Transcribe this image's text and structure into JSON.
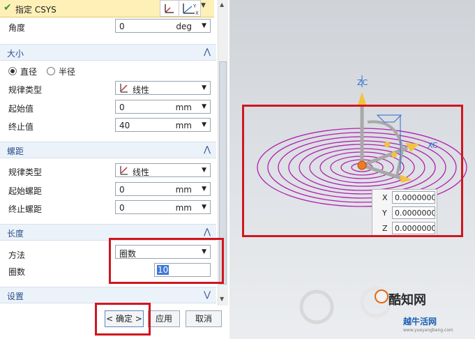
{
  "csys": {
    "label": "指定 CSYS"
  },
  "angle": {
    "label": "角度",
    "value": "0",
    "unit": "deg"
  },
  "size": {
    "title": "大小",
    "radio_diameter": "直径",
    "radio_radius": "半径",
    "law_type_label": "规律类型",
    "law_type_value": "线性",
    "start_label": "起始值",
    "start_value": "0",
    "start_unit": "mm",
    "end_label": "终止值",
    "end_value": "40",
    "end_unit": "mm"
  },
  "pitch": {
    "title": "螺距",
    "law_type_label": "规律类型",
    "law_type_value": "线性",
    "start_label": "起始螺距",
    "start_value": "0",
    "start_unit": "mm",
    "end_label": "终止螺距",
    "end_value": "0",
    "end_unit": "mm"
  },
  "length": {
    "title": "长度",
    "method_label": "方法",
    "method_value": "圈数",
    "turns_label": "圈数",
    "turns_value": "10"
  },
  "settings": {
    "title": "设置"
  },
  "buttons": {
    "ok": "< 确定 >",
    "apply": "应用",
    "cancel": "取消"
  },
  "viewport": {
    "axis_z": "ZC",
    "axis_x": "XC",
    "coords": [
      {
        "axis": "X",
        "value": "0.0000000"
      },
      {
        "axis": "Y",
        "value": "0.0000000"
      },
      {
        "axis": "Z",
        "value": "0.0000000"
      }
    ]
  },
  "watermark": {
    "brand": "酷知网",
    "cn": "越牛活网",
    "url": "www.yueyangbang.com"
  },
  "colors": {
    "highlight_red": "#d0161f",
    "spiral": "#b020b0",
    "section_text": "#2a4f8a"
  }
}
